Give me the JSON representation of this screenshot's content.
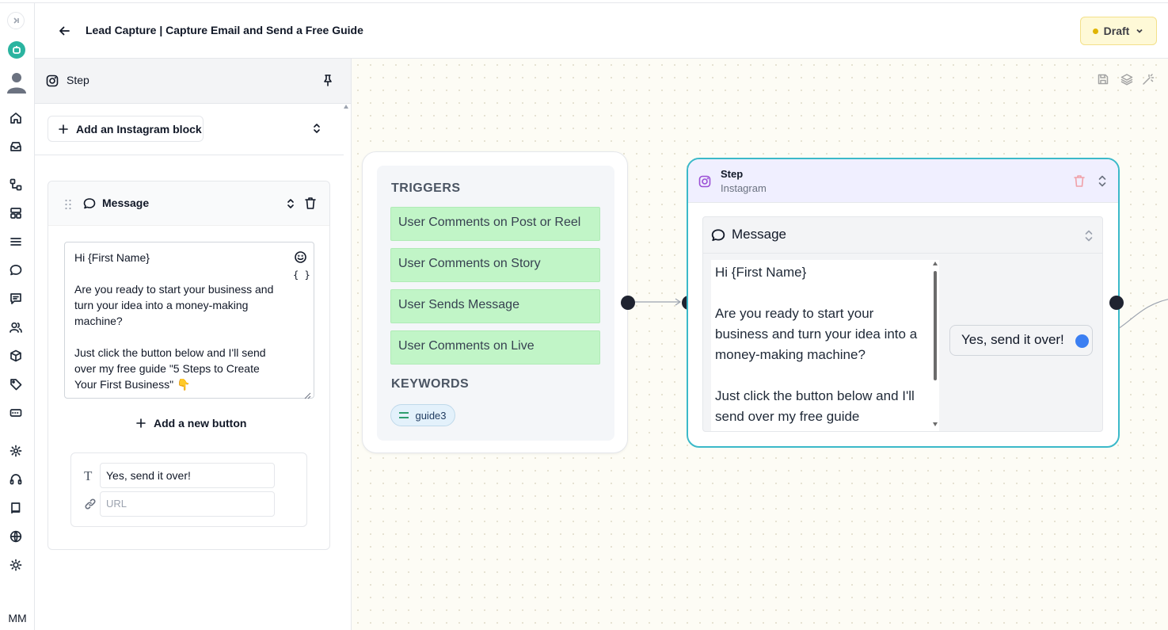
{
  "header": {
    "title": "Lead Capture | Capture Email and Send a Free Guide",
    "status": "Draft"
  },
  "user": {
    "initials": "MM"
  },
  "panel": {
    "title": "Step",
    "add_block_label": "Add an Instagram block",
    "message_block": {
      "label": "Message",
      "text": "Hi {First Name}\n\nAre you ready to start your business and turn your idea into a money-making machine?\n\nJust click the button below and I'll send over my free guide \"5 Steps to Create Your First Business\" 👇",
      "vars_label": "{ }"
    },
    "add_button_label": "Add a new button",
    "button": {
      "text": "Yes, send it over!",
      "url_placeholder": "URL"
    }
  },
  "canvas": {
    "trigger_node": {
      "triggers_heading": "TRIGGERS",
      "triggers": [
        "User Comments on Post or Reel",
        "User Comments on Story",
        "User Sends Message",
        "User Comments on Live"
      ],
      "keywords_heading": "KEYWORDS",
      "keywords": [
        "guide3"
      ]
    },
    "step_node": {
      "title": "Step",
      "subtitle": "Instagram",
      "message_label": "Message",
      "message_text": "Hi {First Name}\n\nAre you ready to start your business and turn your idea into a money-making machine?\n\nJust click the button below and I'll send over my free guide",
      "button_label": "Yes, send it over!"
    }
  },
  "colors": {
    "trigger_bg": "#c1f5c7",
    "step_border": "#3bb9c9",
    "draft_bg": "#fef9d7",
    "port_active": "#3b7ff2"
  }
}
